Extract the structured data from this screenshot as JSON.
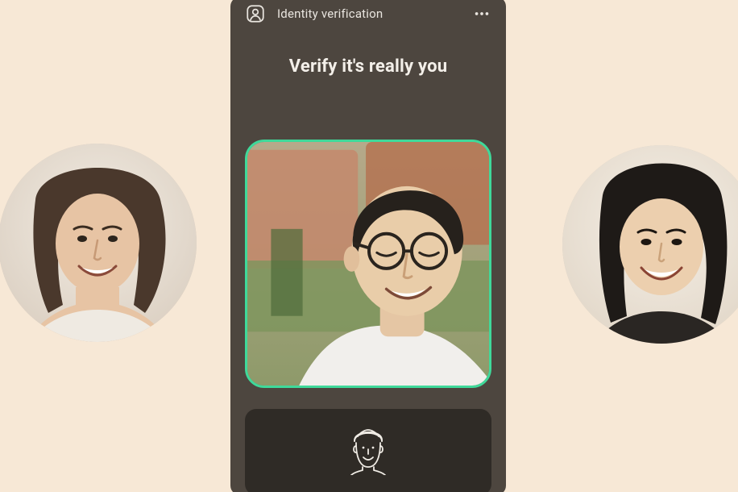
{
  "colors": {
    "page_bg": "#f7e8d6",
    "phone_bg": "#4d463f",
    "card_bg": "#2f2b26",
    "accent_border": "#3fd99a",
    "text": "#f3efe9"
  },
  "topbar": {
    "icon": "identity-icon",
    "title": "Identity verification",
    "more_icon": "more-horizontal-icon"
  },
  "headline": "Verify it's really you",
  "viewfinder": {
    "state": "face-detected",
    "border_color": "#3fd99a"
  },
  "instruction": {
    "icon": "face-outline-icon"
  },
  "avatars": {
    "left": {
      "alt": "example-user-1"
    },
    "right": {
      "alt": "example-user-2"
    }
  }
}
